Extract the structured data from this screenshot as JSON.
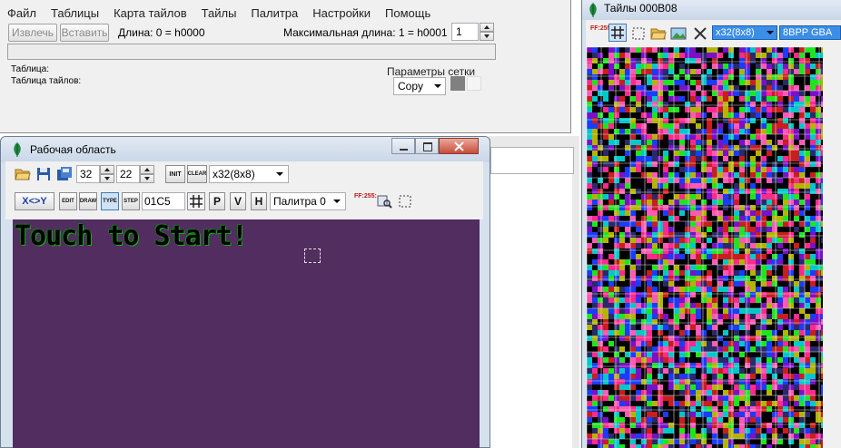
{
  "main": {
    "menu": [
      "Файл",
      "Таблицы",
      "Карта тайлов",
      "Тайлы",
      "Палитра",
      "Настройки",
      "Помощь"
    ],
    "extract_label": "Извлечь",
    "insert_label": "Вставить",
    "length_text": "Длина: 0 = h0000",
    "max_length_text": "Максимальная длина: 1 = h0001",
    "max_length_value": "1",
    "table_label": "Таблица:",
    "tile_table_label": "Таблица тайлов:",
    "grid_params_title": "Параметры сетки",
    "copy_mode": "Copy",
    "colors": {
      "swatch1": "#808080",
      "swatch2": "#f5f5f5"
    }
  },
  "workspace": {
    "title": "Рабочая область",
    "width_value": "32",
    "height_value": "22",
    "init_label": "INIT",
    "clear_label": "CLEAR",
    "tile_size": "x32(8x8)",
    "swap_label": "X<>Y",
    "edit_label": "EDIT",
    "draw_label": "DRAW",
    "type_label": "TYPE",
    "step_label": "STEP",
    "tile_id": "01C5",
    "p_label": "P",
    "v_label": "V",
    "h_label": "H",
    "palette": "Палитра 0",
    "ff_label": "FF:255:",
    "canvas_text": "Touch to Start!",
    "colors": {
      "canvas_bg": "#512d60",
      "text_green": "#18b018"
    }
  },
  "tiles": {
    "title": "Тайлы 000B08",
    "tile_size": "x32(8x8)",
    "bpp_mode": "8BPP GBA",
    "ff_label": "FF:255:"
  }
}
